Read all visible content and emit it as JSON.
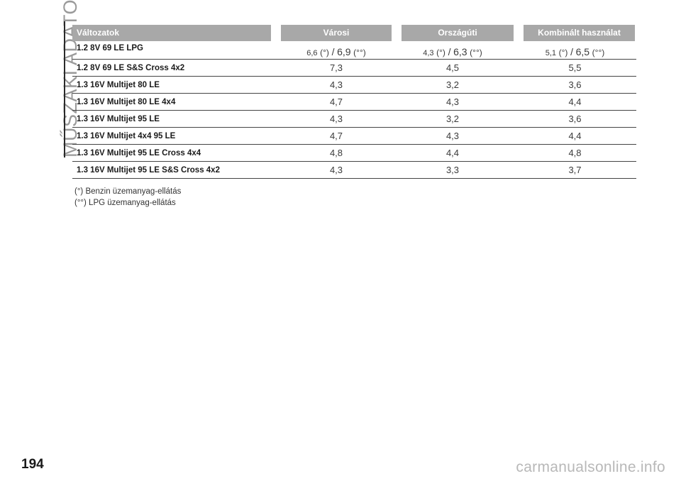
{
  "side_title": "MŰSZAKI ADATOK",
  "table": {
    "headers": [
      "Változatok",
      "Városi",
      "Országúti",
      "Kombinált használat"
    ],
    "rows": [
      {
        "name": "1.2 8V 69 LE LPG",
        "city": {
          "a": "6,6",
          "a_mark": "(°)",
          "sep": "/",
          "b": "6,9",
          "b_mark": "(°°)"
        },
        "road": {
          "a": "4,3",
          "a_mark": "(°)",
          "sep": "/",
          "b": "6,3",
          "b_mark": "(°°)"
        },
        "combined": {
          "a": "5,1",
          "a_mark": "(°)",
          "sep": "/",
          "b": "6,5",
          "b_mark": "(°°)"
        }
      },
      {
        "name": "1.2 8V 69 LE S&S Cross 4x2",
        "city": "7,3",
        "road": "4,5",
        "combined": "5,5"
      },
      {
        "name": "1.3 16V Multijet 80 LE",
        "city": "4,3",
        "road": "3,2",
        "combined": "3,6"
      },
      {
        "name": "1.3 16V Multijet 80 LE 4x4",
        "city": "4,7",
        "road": "4,3",
        "combined": "4,4"
      },
      {
        "name": "1.3 16V Multijet 95 LE",
        "city": "4,3",
        "road": "3,2",
        "combined": "3,6"
      },
      {
        "name": "1.3 16V Multijet 4x4 95 LE",
        "city": "4,7",
        "road": "4,3",
        "combined": "4,4"
      },
      {
        "name": "1.3 16V Multijet 95 LE Cross 4x4",
        "city": "4,8",
        "road": "4,4",
        "combined": "4,8"
      },
      {
        "name": "1.3 16V Multijet 95 LE S&S Cross 4x2",
        "city": "4,3",
        "road": "3,3",
        "combined": "3,7"
      }
    ]
  },
  "footnotes": [
    "(°) Benzin üzemanyag-ellátás",
    "(°°) LPG üzemanyag-ellátás"
  ],
  "page_number": "194",
  "watermark": "carmanualsonline.info"
}
